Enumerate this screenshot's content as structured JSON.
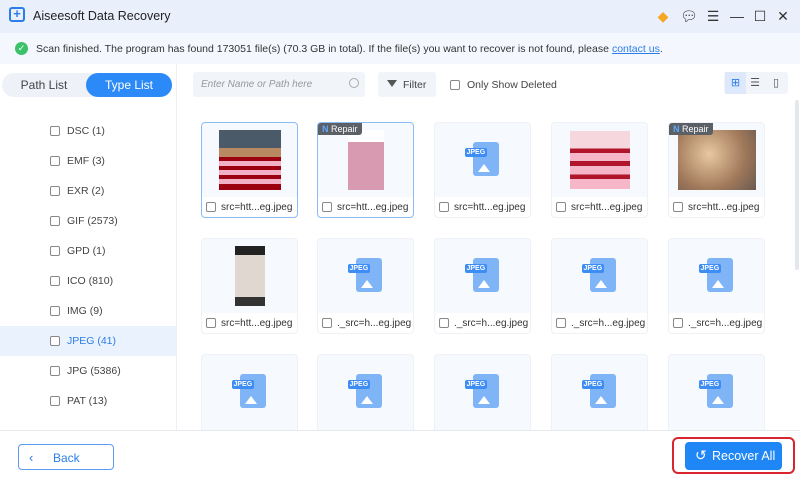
{
  "app": {
    "title": "Aiseesoft Data Recovery"
  },
  "notice": {
    "text": "Scan finished. The program has found 173051 file(s) (70.3 GB in total). If the file(s) you want to recover is not found, please",
    "link": "contact us",
    "end": "."
  },
  "sidebar": {
    "tabs": [
      {
        "label": "Path List"
      },
      {
        "label": "Type List",
        "active": true
      }
    ],
    "types": [
      {
        "label": "DSC (1)"
      },
      {
        "label": "EMF (3)"
      },
      {
        "label": "EXR (2)"
      },
      {
        "label": "GIF (2573)"
      },
      {
        "label": "GPD (1)"
      },
      {
        "label": "ICO (810)"
      },
      {
        "label": "IMG (9)"
      },
      {
        "label": "JPEG (41)",
        "selected": true
      },
      {
        "label": "JPG (5386)"
      },
      {
        "label": "PAT (13)"
      }
    ]
  },
  "toolbar": {
    "search_placeholder": "Enter Name or Path here",
    "filter": "Filter",
    "only_deleted": "Only Show Deleted",
    "view": "grid"
  },
  "files": [
    {
      "name": "src=htt...eg.jpeg",
      "thumb": "img1",
      "selected": true
    },
    {
      "name": "src=htt...eg.jpeg",
      "thumb": "img2",
      "selected": true,
      "badge": "Repair"
    },
    {
      "name": "src=htt...eg.jpeg",
      "thumb": "icon"
    },
    {
      "name": "src=htt...eg.jpeg",
      "thumb": "img3"
    },
    {
      "name": "src=htt...eg.jpeg",
      "thumb": "img4",
      "badge": "Repair"
    },
    {
      "name": "src=htt...eg.jpeg",
      "thumb": "img5"
    },
    {
      "name": "._src=h...eg.jpeg",
      "thumb": "icon"
    },
    {
      "name": "._src=h...eg.jpeg",
      "thumb": "icon"
    },
    {
      "name": "._src=h...eg.jpeg",
      "thumb": "icon"
    },
    {
      "name": "._src=h...eg.jpeg",
      "thumb": "icon"
    },
    {
      "name": "",
      "thumb": "icon"
    },
    {
      "name": "",
      "thumb": "icon"
    },
    {
      "name": "",
      "thumb": "icon"
    },
    {
      "name": "",
      "thumb": "icon"
    },
    {
      "name": "",
      "thumb": "icon"
    }
  ],
  "file_icon_tag": "JPEG",
  "footer": {
    "back": "Back",
    "recover_all": "Recover All"
  },
  "colors": {
    "accent": "#1f86f5",
    "highlight": "#d9252d",
    "success": "#3cc26a"
  }
}
